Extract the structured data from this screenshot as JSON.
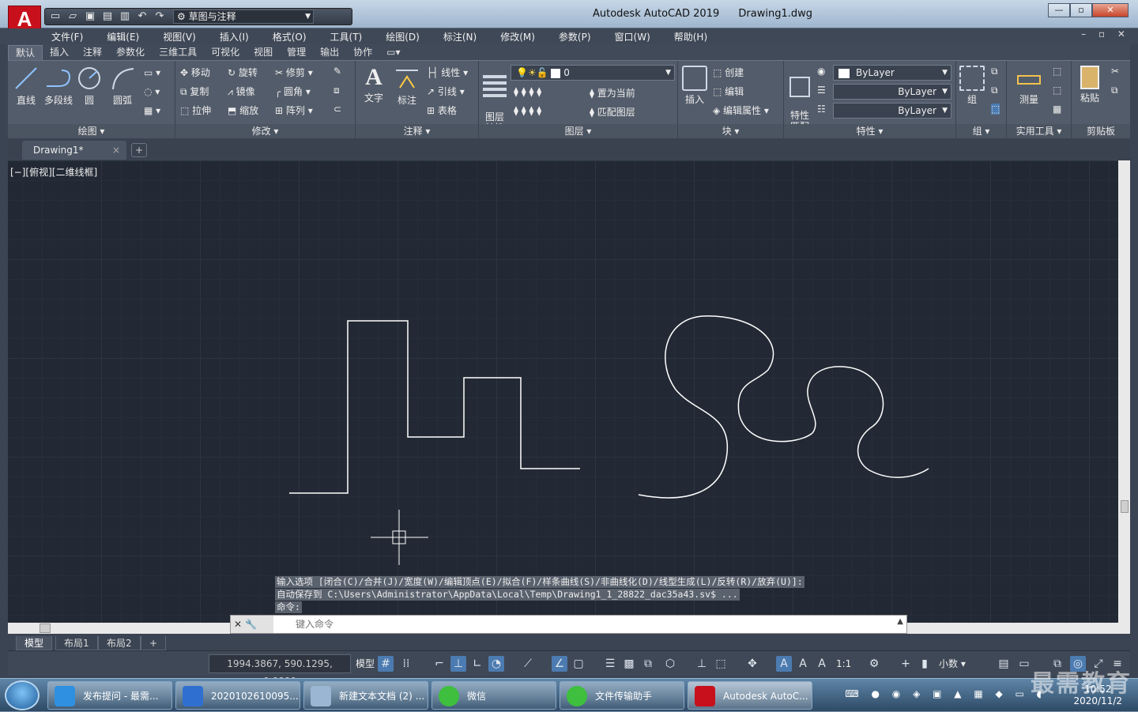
{
  "app": {
    "logo_letter": "A",
    "title": "Autodesk AutoCAD 2019",
    "file": "Drawing1.dwg"
  },
  "qat": {
    "workspace": "草图与注释"
  },
  "window_controls": {
    "minimize": "—",
    "restore": "▫",
    "close": "✕"
  },
  "menu": [
    "文件(F)",
    "编辑(E)",
    "视图(V)",
    "插入(I)",
    "格式(O)",
    "工具(T)",
    "绘图(D)",
    "标注(N)",
    "修改(M)",
    "参数(P)",
    "窗口(W)",
    "帮助(H)"
  ],
  "ribbon_tabs": [
    "默认",
    "插入",
    "注释",
    "参数化",
    "三维工具",
    "可视化",
    "视图",
    "管理",
    "输出",
    "协作"
  ],
  "panels": {
    "draw": {
      "label": "绘图 ▾",
      "line": "直线",
      "polyline": "多段线",
      "circle": "圆",
      "arc": "圆弧"
    },
    "modify": {
      "label": "修改 ▾",
      "move": "移动",
      "rotate": "旋转",
      "trim": "修剪",
      "copy": "复制",
      "mirror": "镜像",
      "fillet": "圆角",
      "stretch": "拉伸",
      "scale": "缩放",
      "array": "阵列"
    },
    "annotation": {
      "label": "注释 ▾",
      "text": "文字",
      "dimension": "标注",
      "linear": "线性",
      "leader": "引线",
      "table": "表格"
    },
    "layers": {
      "label": "图层 ▾",
      "layer_props": "图层\n特性",
      "current_layer": "0",
      "set_current": "置为当前",
      "match_layer": "匹配图层"
    },
    "block": {
      "label": "块 ▾",
      "insert": "插入",
      "create": "创建",
      "edit": "编辑",
      "edit_attr": "编辑属性"
    },
    "properties": {
      "label": "特性 ▾",
      "match": "特性\n匹配",
      "color": "ByLayer",
      "linetype": "ByLayer",
      "lineweight": "ByLayer"
    },
    "groups": {
      "label": "组 ▾",
      "group": "组"
    },
    "utilities": {
      "label": "实用工具 ▾",
      "measure": "测量"
    },
    "clipboard": {
      "label": "剪贴板",
      "paste": "粘贴"
    }
  },
  "doc_tab": {
    "name": "Drawing1*",
    "close": "×",
    "add": "+"
  },
  "viewport_label": "[−][俯视][二维线框]",
  "command": {
    "history": [
      "输入选项 [闭合(C)/合并(J)/宽度(W)/编辑顶点(E)/拟合(F)/样条曲线(S)/非曲线化(D)/线型生成(L)/反转(R)/放弃(U)]:",
      "自动保存到 C:\\Users\\Administrator\\AppData\\Local\\Temp\\Drawing1_1_28822_dac35a43.sv$ ...",
      "命令:"
    ],
    "placeholder": "键入命令"
  },
  "layout_tabs": [
    "模型",
    "布局1",
    "布局2",
    "+"
  ],
  "status": {
    "coords": "1994.3867, 590.1295, 0.0000",
    "model": "模型",
    "scale": "1:1",
    "units": "小数"
  },
  "taskbar": {
    "items": [
      "发布提问 - 最需...",
      "2020102610095...",
      "新建文本文档 (2) ...",
      "微信",
      "文件传输助手",
      "Autodesk AutoC..."
    ],
    "time": "10:52",
    "date": "2020/11/2"
  },
  "watermark": "最需教育"
}
